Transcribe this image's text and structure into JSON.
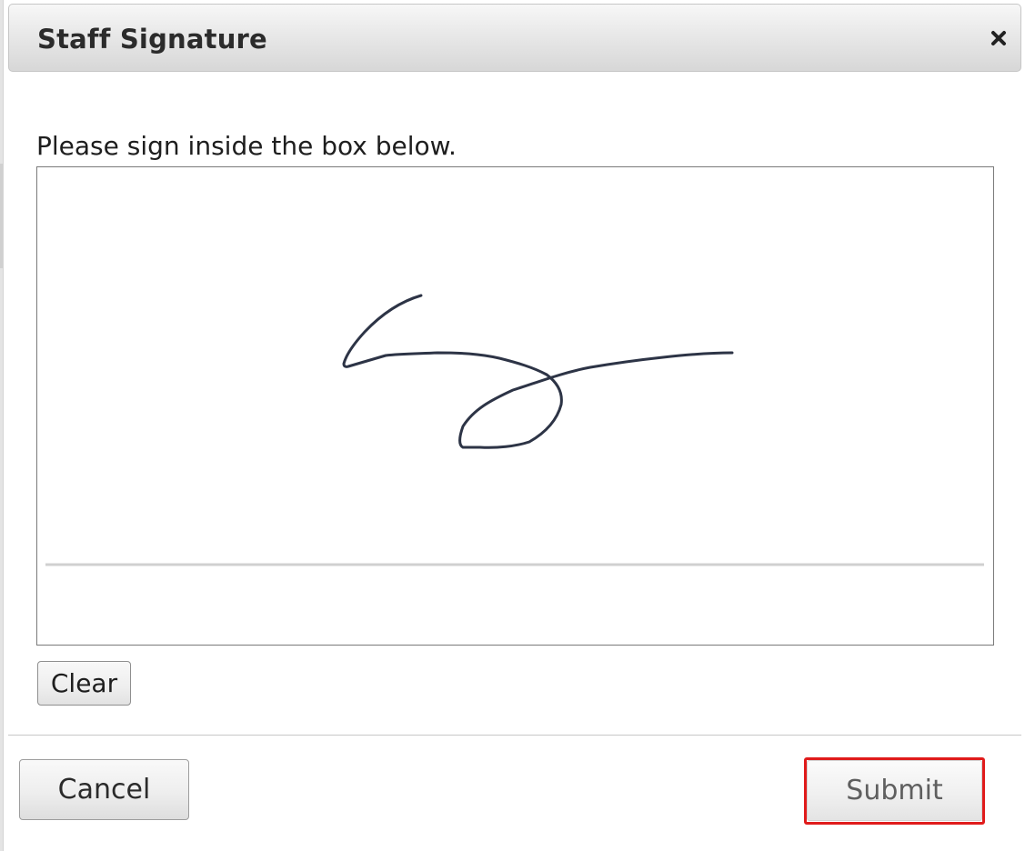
{
  "dialog": {
    "title": "Staff Signature",
    "close_icon": "close-icon",
    "instruction": "Please sign inside the box below.",
    "signature_status": "signed"
  },
  "signature_pad": {
    "clear_label": "Clear",
    "stroke_color": "#2d3446",
    "baseline_color": "#d0d0d0"
  },
  "footer": {
    "cancel_label": "Cancel",
    "submit_label": "Submit",
    "submit_highlight_color": "#e01b1b"
  }
}
